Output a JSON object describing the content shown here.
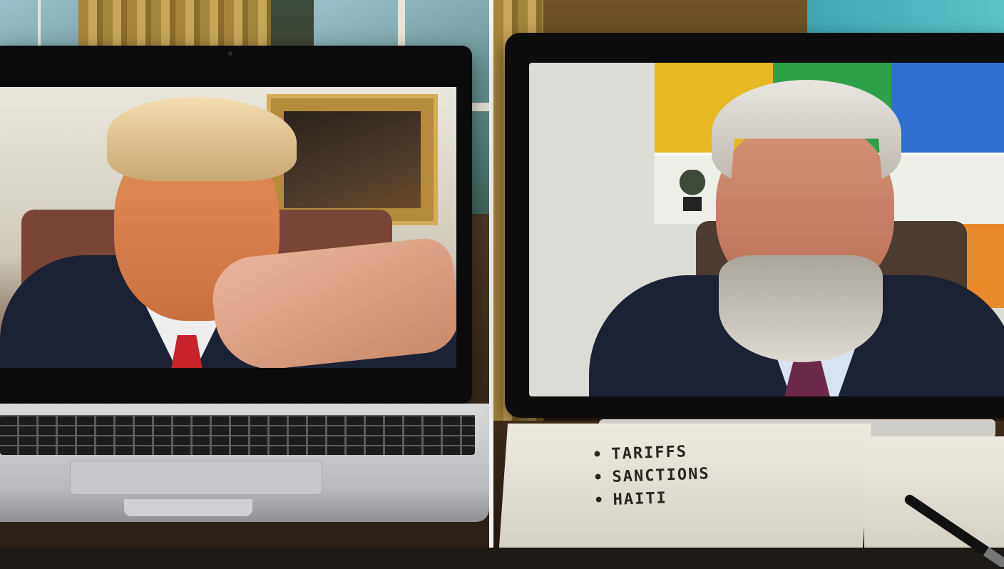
{
  "scene": {
    "description_free": true
  },
  "notepad": {
    "items": [
      "TARIFFS",
      "SANCTIONS",
      "HAITI"
    ]
  },
  "colors": {
    "divider": "#f4f4f2",
    "left_tie": "#c8222a",
    "right_tie": "#6b2a4a",
    "suit": "#1b2233",
    "wall_yellow": "#e6b823",
    "wall_green": "#2fa04a",
    "wall_blue": "#2f6fd0",
    "wall_orange": "#e98a2a"
  }
}
